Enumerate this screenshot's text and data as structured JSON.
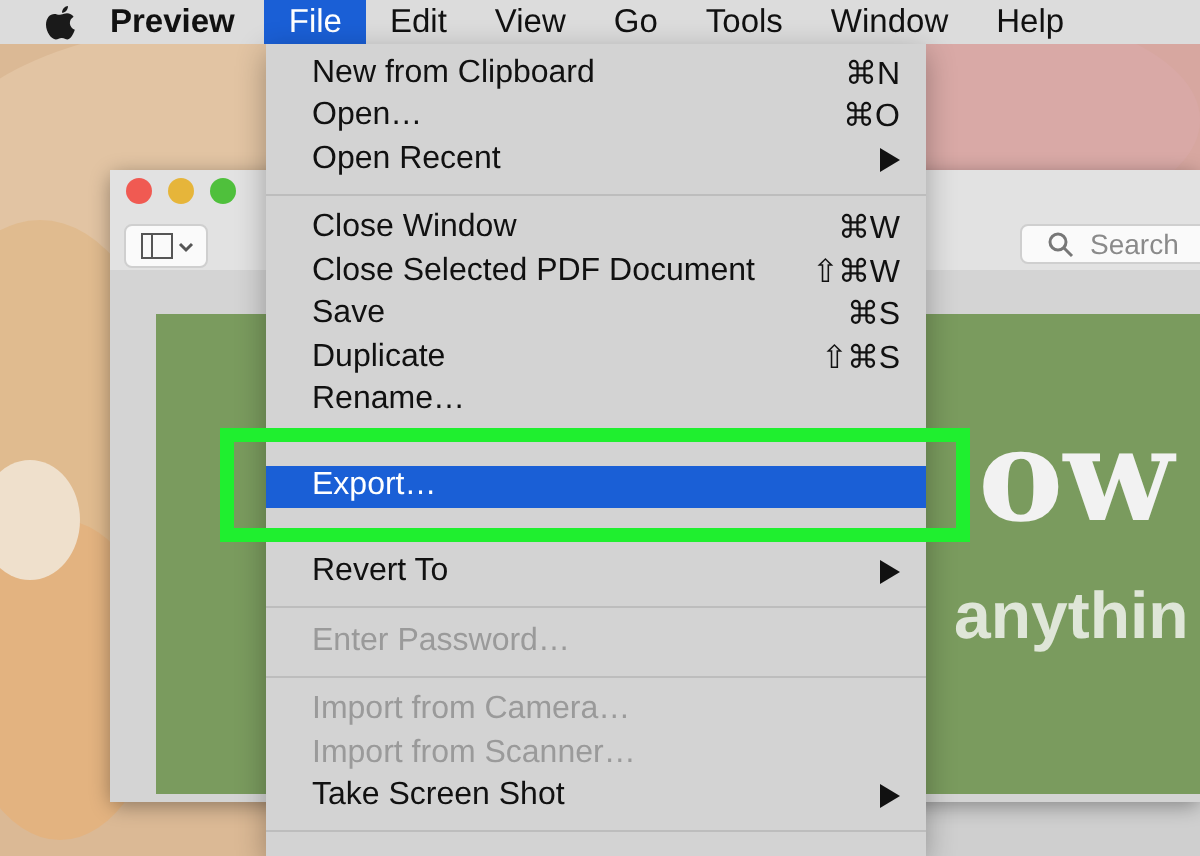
{
  "menu_bar": {
    "app": "Preview",
    "items": [
      {
        "label": "File",
        "selected": true
      },
      {
        "label": "Edit",
        "selected": false
      },
      {
        "label": "View",
        "selected": false
      },
      {
        "label": "Go",
        "selected": false
      },
      {
        "label": "Tools",
        "selected": false
      },
      {
        "label": "Window",
        "selected": false
      },
      {
        "label": "Help",
        "selected": false
      }
    ]
  },
  "window": {
    "search": {
      "placeholder": "Search"
    },
    "document": {
      "headline": "ow",
      "subline": "anythin"
    }
  },
  "file_menu": {
    "items": [
      {
        "kind": "item",
        "label": "New from Clipboard",
        "shortcut": "⌘N",
        "submenu": false,
        "disabled": false,
        "selected": false
      },
      {
        "kind": "item",
        "label": "Open…",
        "shortcut": "⌘O",
        "submenu": false,
        "disabled": false,
        "selected": false
      },
      {
        "kind": "item",
        "label": "Open Recent",
        "submenu": true,
        "disabled": false,
        "selected": false
      },
      {
        "kind": "separator"
      },
      {
        "kind": "item",
        "label": "Close Window",
        "shortcut": "⌘W",
        "submenu": false,
        "disabled": false,
        "selected": false
      },
      {
        "kind": "item",
        "label": "Close Selected PDF Document",
        "shortcut": "⇧⌘W",
        "submenu": false,
        "disabled": false,
        "selected": false
      },
      {
        "kind": "item",
        "label": "Save",
        "shortcut": "⌘S",
        "submenu": false,
        "disabled": false,
        "selected": false
      },
      {
        "kind": "item",
        "label": "Duplicate",
        "shortcut": "⇧⌘S",
        "submenu": false,
        "disabled": false,
        "selected": false
      },
      {
        "kind": "item",
        "label": "Rename…",
        "submenu": false,
        "disabled": false,
        "selected": false
      },
      {
        "kind": "covered"
      },
      {
        "kind": "item",
        "label": "Export…",
        "submenu": false,
        "disabled": false,
        "selected": true
      },
      {
        "kind": "covered"
      },
      {
        "kind": "item",
        "label": "Revert To",
        "submenu": true,
        "disabled": false,
        "selected": false
      },
      {
        "kind": "separator"
      },
      {
        "kind": "item",
        "label": "Enter Password…",
        "submenu": false,
        "disabled": true,
        "selected": false
      },
      {
        "kind": "separator"
      },
      {
        "kind": "item",
        "label": "Import from Camera…",
        "submenu": false,
        "disabled": true,
        "selected": false
      },
      {
        "kind": "item",
        "label": "Import from Scanner…",
        "submenu": false,
        "disabled": true,
        "selected": false
      },
      {
        "kind": "item",
        "label": "Take Screen Shot",
        "submenu": true,
        "disabled": false,
        "selected": false
      },
      {
        "kind": "separator"
      }
    ]
  }
}
